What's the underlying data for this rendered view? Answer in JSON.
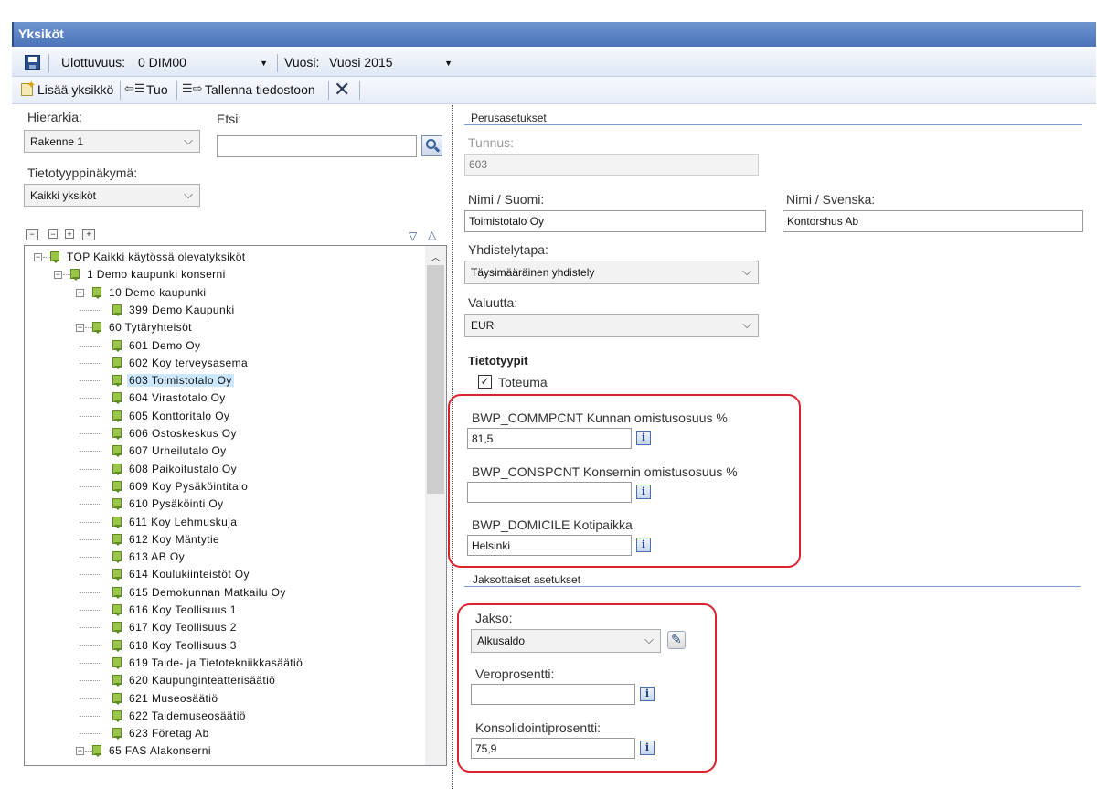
{
  "window": {
    "title": "Yksiköt"
  },
  "toolbar1": {
    "dimension_label": "Ulottuvuus:",
    "dimension_value": "0 DIM00",
    "year_label": "Vuosi:",
    "year_value": "Vuosi 2015"
  },
  "toolbar2": {
    "add_unit": "Lisää yksikkö",
    "import": "Tuo",
    "save_to_file": "Tallenna tiedostoon"
  },
  "left": {
    "hierarchy_label": "Hierarkia:",
    "hierarchy_value": "Rakenne 1",
    "search_label": "Etsi:",
    "search_value": "",
    "datatype_view_label": "Tietotyyppinäkymä:",
    "datatype_view_value": "Kaikki yksiköt"
  },
  "tree": {
    "items": [
      {
        "label": "TOP Kaikki käytössä olevatyksiköt",
        "level": 0,
        "expander": "−",
        "selected": false
      },
      {
        "label": "1 Demo kaupunki konserni",
        "level": 1,
        "expander": "−",
        "selected": false
      },
      {
        "label": "10 Demo kaupunki",
        "level": 2,
        "expander": "−",
        "selected": false
      },
      {
        "label": "399 Demo Kaupunki",
        "level": 3,
        "expander": "",
        "selected": false
      },
      {
        "label": "60 Tytäryhteisöt",
        "level": 2,
        "expander": "−",
        "selected": false
      },
      {
        "label": "601 Demo Oy",
        "level": 3,
        "expander": "",
        "selected": false
      },
      {
        "label": "602 Koy terveysasema",
        "level": 3,
        "expander": "",
        "selected": false
      },
      {
        "label": "603 Toimistotalo Oy",
        "level": 3,
        "expander": "",
        "selected": true
      },
      {
        "label": "604 Virastotalo Oy",
        "level": 3,
        "expander": "",
        "selected": false
      },
      {
        "label": "605 Konttoritalo Oy",
        "level": 3,
        "expander": "",
        "selected": false
      },
      {
        "label": "606 Ostoskeskus Oy",
        "level": 3,
        "expander": "",
        "selected": false
      },
      {
        "label": "607 Urheilutalo Oy",
        "level": 3,
        "expander": "",
        "selected": false
      },
      {
        "label": "608 Paikoitustalo Oy",
        "level": 3,
        "expander": "",
        "selected": false
      },
      {
        "label": "609 Koy Pysäköintitalo",
        "level": 3,
        "expander": "",
        "selected": false
      },
      {
        "label": "610 Pysäköinti Oy",
        "level": 3,
        "expander": "",
        "selected": false
      },
      {
        "label": "611 Koy Lehmuskuja",
        "level": 3,
        "expander": "",
        "selected": false
      },
      {
        "label": "612 Koy Mäntytie",
        "level": 3,
        "expander": "",
        "selected": false
      },
      {
        "label": "613 AB Oy",
        "level": 3,
        "expander": "",
        "selected": false
      },
      {
        "label": "614 Koulukiinteistöt Oy",
        "level": 3,
        "expander": "",
        "selected": false
      },
      {
        "label": "615 Demokunnan Matkailu Oy",
        "level": 3,
        "expander": "",
        "selected": false
      },
      {
        "label": "616 Koy Teollisuus 1",
        "level": 3,
        "expander": "",
        "selected": false
      },
      {
        "label": "617 Koy Teollisuus 2",
        "level": 3,
        "expander": "",
        "selected": false
      },
      {
        "label": "618 Koy Teollisuus 3",
        "level": 3,
        "expander": "",
        "selected": false
      },
      {
        "label": "619 Taide- ja Tietotekniikkasäätiö",
        "level": 3,
        "expander": "",
        "selected": false
      },
      {
        "label": "620 Kaupunginteatterisäätiö",
        "level": 3,
        "expander": "",
        "selected": false
      },
      {
        "label": "621 Museosäätiö",
        "level": 3,
        "expander": "",
        "selected": false
      },
      {
        "label": "622 Taidemuseosäätiö",
        "level": 3,
        "expander": "",
        "selected": false
      },
      {
        "label": "623 Företag Ab",
        "level": 3,
        "expander": "",
        "selected": false
      },
      {
        "label": "65 FAS Alakonserni",
        "level": 2,
        "expander": "−",
        "selected": false
      }
    ]
  },
  "right": {
    "basic_settings_title": "Perusasetukset",
    "code_label": "Tunnus:",
    "code_value": "603",
    "name_fi_label": "Nimi / Suomi:",
    "name_fi_value": "Toimistotalo Oy",
    "name_sv_label": "Nimi / Svenska:",
    "name_sv_value": "Kontorshus Ab",
    "consolidation_label": "Yhdistelytapa:",
    "consolidation_value": "Täysimääräinen yhdistely",
    "currency_label": "Valuutta:",
    "currency_value": "EUR",
    "datatypes_title": "Tietotyypit",
    "actual_label": "Toteuma",
    "actual_checked": true,
    "commpcnt_label": "BWP_COMMPCNT Kunnan omistusosuus %",
    "commpcnt_value": "81,5",
    "conspcnt_label": "BWP_CONSPCNT Konsernin omistusosuus %",
    "conspcnt_value": "",
    "domicile_label": "BWP_DOMICILE Kotipaikka",
    "domicile_value": "Helsinki",
    "periodic_settings_title": "Jaksottaiset asetukset",
    "period_label": "Jakso:",
    "period_value": "Alkusaldo",
    "tax_rate_label": "Veroprosentti:",
    "tax_rate_value": "",
    "consolidation_pct_label": "Konsolidointiprosentti:",
    "consolidation_pct_value": "75,9"
  },
  "colors": {
    "titlebar": "#4a74b8",
    "callout": "#d9232e",
    "selection": "#cce8ff",
    "section_line": "#7a9ccf"
  }
}
